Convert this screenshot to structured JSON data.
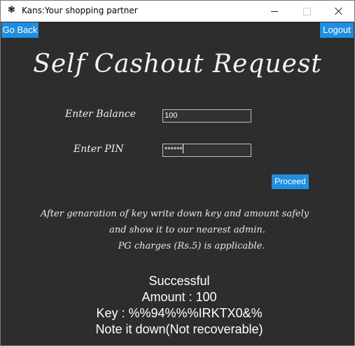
{
  "window": {
    "title": "Kans:Your shopping partner",
    "icon": "app-logo-icon"
  },
  "nav": {
    "go_back_label": "Go Back",
    "logout_label": "Logout",
    "accent_color": "#1f8ee0"
  },
  "form": {
    "heading": "Self Cashout Request",
    "balance_label": "Enter Balance",
    "balance_value": "100",
    "pin_label": "Enter PIN",
    "pin_value": "******",
    "proceed_label": "Proceed"
  },
  "notice": {
    "line1": "After genaration of key write down key and amount safely",
    "line2": "and show it to our nearest admin.",
    "line3": "PG charges (Rs.5) is applicable."
  },
  "result": {
    "status": "Successful",
    "amount": "Amount : 100",
    "key": "Key : %%94%%%IRKTX0&%",
    "note": "Note it down(Not recoverable)"
  }
}
